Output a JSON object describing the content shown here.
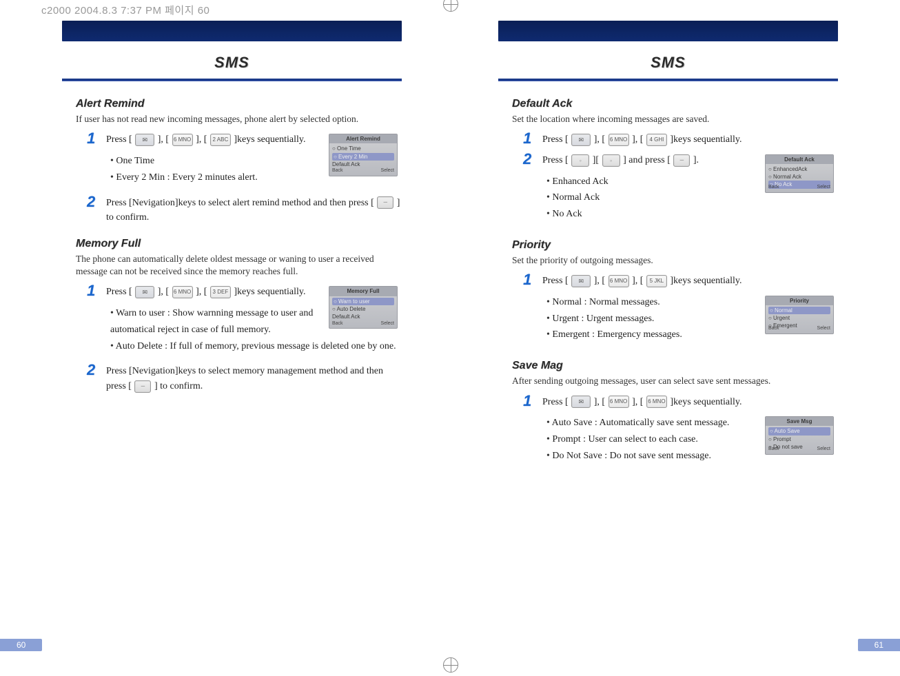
{
  "watermark": "c2000  2004.8.3 7:37 PM  페이지 60",
  "pages": {
    "left": {
      "title": "SMS",
      "pageNum": "60",
      "sections": {
        "alertRemind": {
          "heading": "Alert Remind",
          "desc": "If user has not read new incoming messages, phone alert by selected option.",
          "step1_a": "Press [",
          "step1_b": "], [",
          "step1_c": "], [",
          "step1_d": "]keys sequentially.",
          "key3": "2 ABC",
          "key2": "6 MNO",
          "bullet1": "One Time",
          "bullet2": "Every 2 Min : Every 2 minutes alert.",
          "step2_a": "Press [Nevigation]keys to select alert remind method and then press [",
          "step2_b": "] to confirm.",
          "shot": {
            "title": "Alert Remind",
            "l1": "○ One Time",
            "l2": "○ Every 2 Min",
            "l3": "Default Ack",
            "fL": "Back",
            "fR": "Select"
          }
        },
        "memoryFull": {
          "heading": "Memory Full",
          "desc": "The phone can automatically delete oldest message or waning to user a received message can not be received since the memory reaches full.",
          "step1_a": "Press [",
          "step1_b": "], [",
          "step1_c": "], [",
          "step1_d": "]keys sequentially.",
          "key2": "6 MNO",
          "key3": "3 DEF",
          "bullet1": "Warn to user : Show warnning message to user and automatical reject in case of full memory.",
          "bullet2": "Auto Delete : If full of memory, previous message is deleted one by one.",
          "step2_a": "Press [Nevigation]keys to select memory management method and then press [",
          "step2_b": "] to confirm.",
          "shot": {
            "title": "Memory Full",
            "l1": "○ Warn to user",
            "l2": "○ Auto Delete",
            "l3": "Default Ack",
            "fL": "Back",
            "fR": "Select"
          }
        }
      }
    },
    "right": {
      "title": "SMS",
      "pageNum": "61",
      "sections": {
        "defaultAck": {
          "heading": "Default Ack",
          "desc": "Set the location where incoming messages are saved.",
          "step1_a": "Press [",
          "step1_b": "], [",
          "step1_c": "], [",
          "step1_d": "]keys sequentially.",
          "key2": "6 MNO",
          "key3": "4 GHI",
          "step2_a": "Press [",
          "step2_b": "][",
          "step2_c": "] and press [",
          "step2_d": "].",
          "bullet1": "Enhanced Ack",
          "bullet2": "Normal Ack",
          "bullet3": "No Ack",
          "shot": {
            "title": "Default Ack",
            "l1": "○ EnhancedAck",
            "l2": "○ Normal Ack",
            "l3": "○ No Ack",
            "fL": "Back",
            "fR": "Select"
          }
        },
        "priority": {
          "heading": "Priority",
          "desc": "Set the priority of outgoing messages.",
          "step1_a": "Press [",
          "step1_b": "], [",
          "step1_c": "], [",
          "step1_d": "]keys sequentially.",
          "key2": "6 MNO",
          "key3": "5 JKL",
          "bullet1": "Normal : Normal messages.",
          "bullet2": "Urgent : Urgent messages.",
          "bullet3": "Emergent : Emergency messages.",
          "shot": {
            "title": "Priority",
            "l1": "○ Normal",
            "l2": "○ Urgent",
            "l3": "○ Emergent",
            "fL": "Back",
            "fR": "Select"
          }
        },
        "saveMsg": {
          "heading": "Save Mag",
          "desc": "After sending outgoing messages, user can select save sent messages.",
          "step1_a": "Press [",
          "step1_b": "], [",
          "step1_c": "], [",
          "step1_d": "]keys sequentially.",
          "key2": "6 MNO",
          "key3": "6 MNO",
          "bullet1": "Auto Save : Automatically save sent message.",
          "bullet2": "Prompt : User can select to each case.",
          "bullet3": "Do Not Save : Do not save sent message.",
          "shot": {
            "title": "Save Msg",
            "l1": "○ Auto Save",
            "l2": "○ Prompt",
            "l3": "○ Do not save",
            "fL": "Back",
            "fR": "Select"
          }
        }
      }
    }
  }
}
